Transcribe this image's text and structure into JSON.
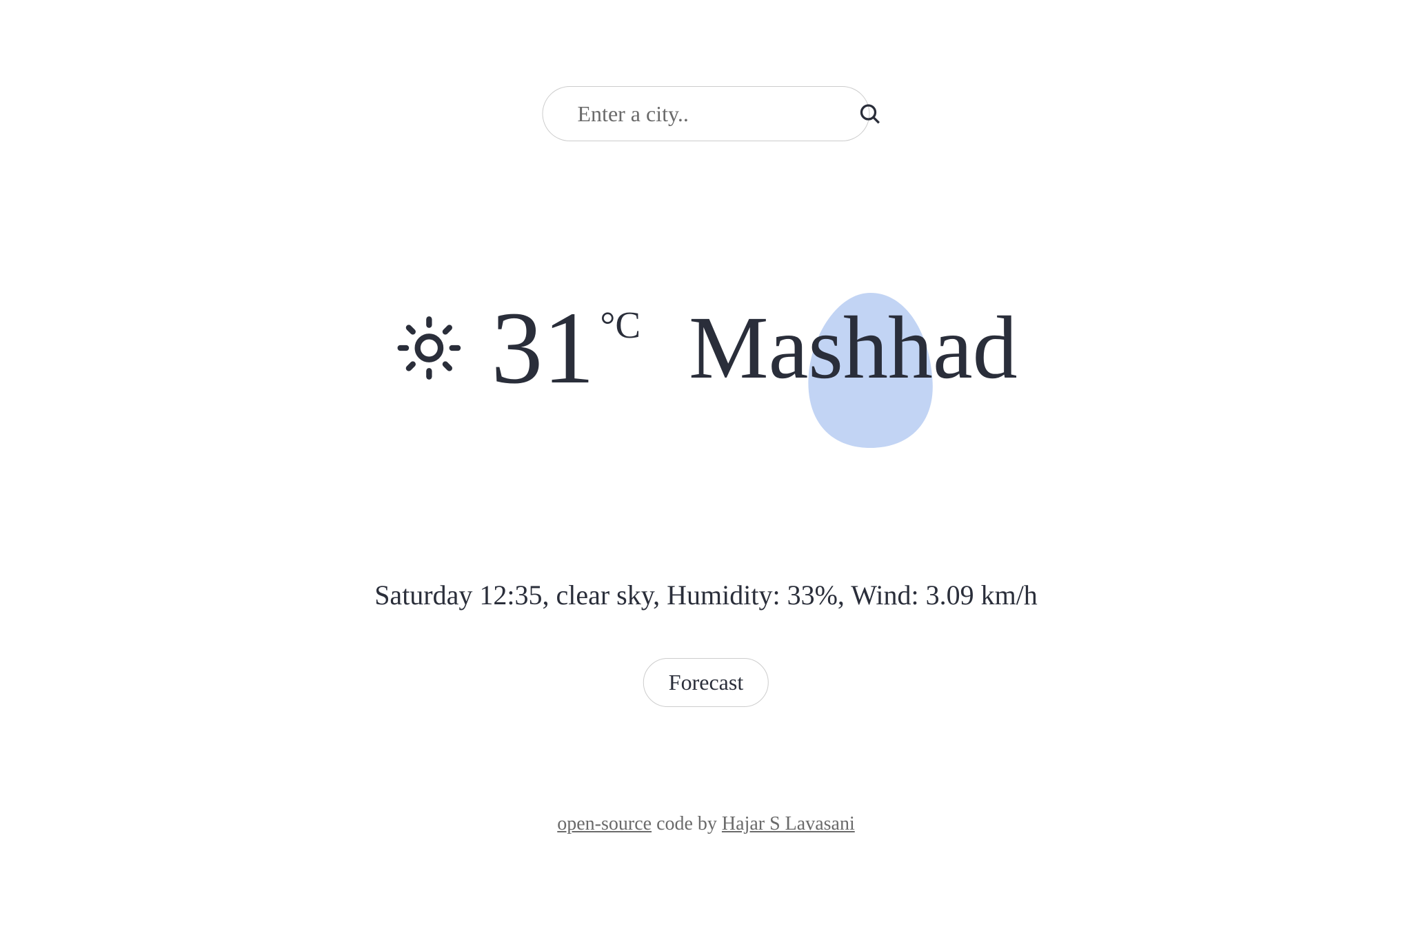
{
  "search": {
    "placeholder": "Enter a city.."
  },
  "weather": {
    "temperature": "31",
    "unit": "°C",
    "city": "Mashhad",
    "details": "Saturday 12:35, clear sky, Humidity: 33%, Wind: 3.09 km/h"
  },
  "forecast": {
    "label": "Forecast"
  },
  "footer": {
    "open_source": "open-source",
    "code_by": " code by ",
    "author": "Hajar S Lavasani"
  }
}
